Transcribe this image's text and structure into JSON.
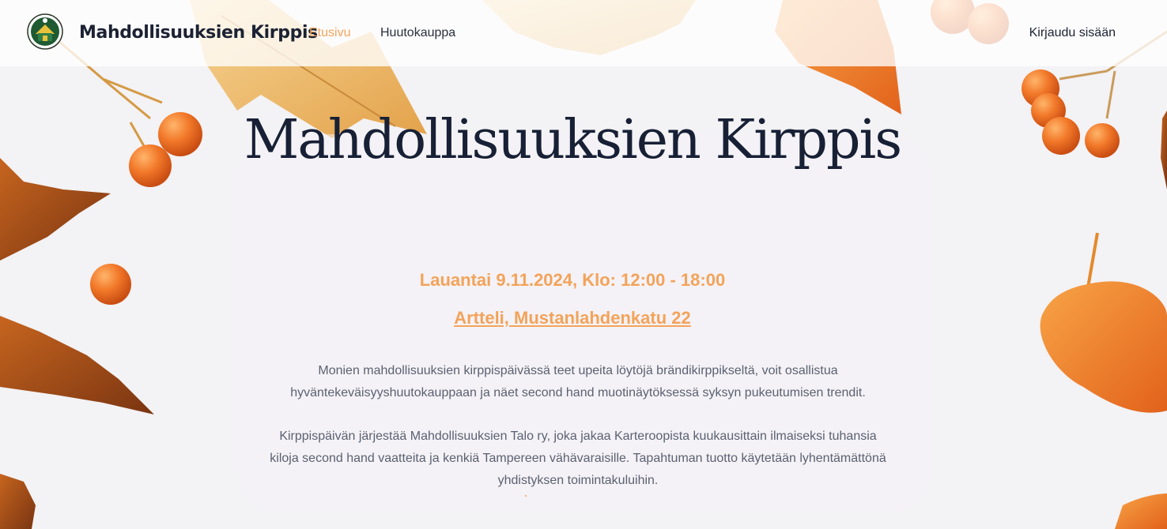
{
  "header": {
    "brand": "Mahdollisuuksien Kirppis",
    "nav": {
      "home": "Etusivu",
      "auction": "Huutokauppa",
      "login": "Kirjaudu sisään"
    }
  },
  "hero": {
    "title": "Mahdollisuuksien Kirppis",
    "date": "Lauantai 9.11.2024, Klo: 12:00 - 18:00",
    "location": "Artteli, Mustanlahdenkatu 22",
    "paragraphs": [
      "Monien mahdollisuuksien kirppispäivässä teet upeita löytöjä brändikirppikseltä, voit osallistua hyväntekeväisyyshuutokauppaan ja näet second hand muotinäytöksessä syksyn pukeutumisen trendit.",
      "Kirppispäivän järjestää Mahdollisuuksien Talo ry, joka jakaa Karteroopista kuukausittain ilmaiseksi tuhansia kiloja second hand vaatteita ja kenkiä Tampereen vähävaraisille. Tapahtuman tuotto käytetään lyhentämättönä yhdistyksen toimintakuluihin."
    ]
  },
  "colors": {
    "accent": "#f3a35a",
    "title": "#172035",
    "body_text": "#5b6172",
    "background": "#f3f2f5"
  }
}
